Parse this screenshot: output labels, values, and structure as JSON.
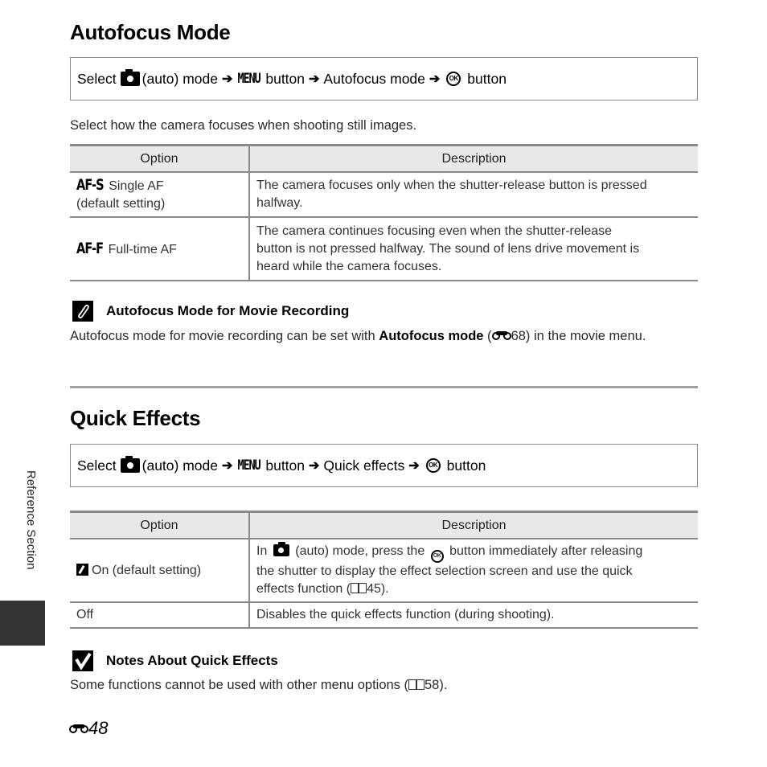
{
  "sections": {
    "autofocus": {
      "title": "Autofocus Mode",
      "nav": {
        "select": "Select",
        "auto_mode": "(auto) mode",
        "menu_key": "MENU",
        "button1": "button",
        "item": "Autofocus mode",
        "ok_key": "OK",
        "button2": "button"
      },
      "intro": "Select how the camera focuses when shooting still images.",
      "table": {
        "headers": [
          "Option",
          "Description"
        ],
        "rows": [
          {
            "icon": "AF-S",
            "option": "Single AF",
            "option_note": "(default setting)",
            "description_lines": [
              "The camera focuses only when the shutter-release button is pressed",
              "halfway."
            ]
          },
          {
            "icon": "AF-F",
            "option": "Full-time AF",
            "description_lines": [
              "The camera continues focusing even when the shutter-release",
              "button is not pressed halfway. The sound of lens drive movement is",
              "heard while the camera focuses."
            ]
          }
        ]
      },
      "note": {
        "icon": "pencil-note-icon",
        "title": "Autofocus Mode for Movie Recording",
        "text_before": "Autofocus mode for movie recording can be set with",
        "text_bold": "Autofocus mode",
        "ref_page": "68",
        "text_after": "in the movie menu."
      }
    },
    "quick_effects": {
      "title": "Quick Effects",
      "nav": {
        "select": "Select",
        "auto_mode": "(auto) mode",
        "menu_key": "MENU",
        "button1": "button",
        "item": "Quick effects",
        "ok_key": "OK",
        "button2": "button"
      },
      "table": {
        "headers": [
          "Option",
          "Description"
        ],
        "rows": [
          {
            "option": "On (default setting)",
            "desc_in": "In",
            "desc_a": "(auto) mode, press the",
            "desc_b": "button immediately after releasing",
            "desc_line2": "the shutter to display the effect selection screen and use the quick",
            "desc_line3_pre": "effects function (",
            "desc_ref": "45",
            "desc_line3_post": ")."
          },
          {
            "option": "Off",
            "description": "Disables the quick effects function (during shooting)."
          }
        ]
      },
      "note": {
        "icon": "check-note-icon",
        "title": "Notes About Quick Effects",
        "text_before": "Some functions cannot be used with other menu options (",
        "ref_page": "58",
        "text_after": ")."
      }
    }
  },
  "sidebar": {
    "label": "Reference Section"
  },
  "footer": {
    "page_number": "48"
  },
  "colors": {
    "rule": "#a0a0a0",
    "table_header_bg": "#e8e8e8",
    "side_tab": "#333333"
  }
}
